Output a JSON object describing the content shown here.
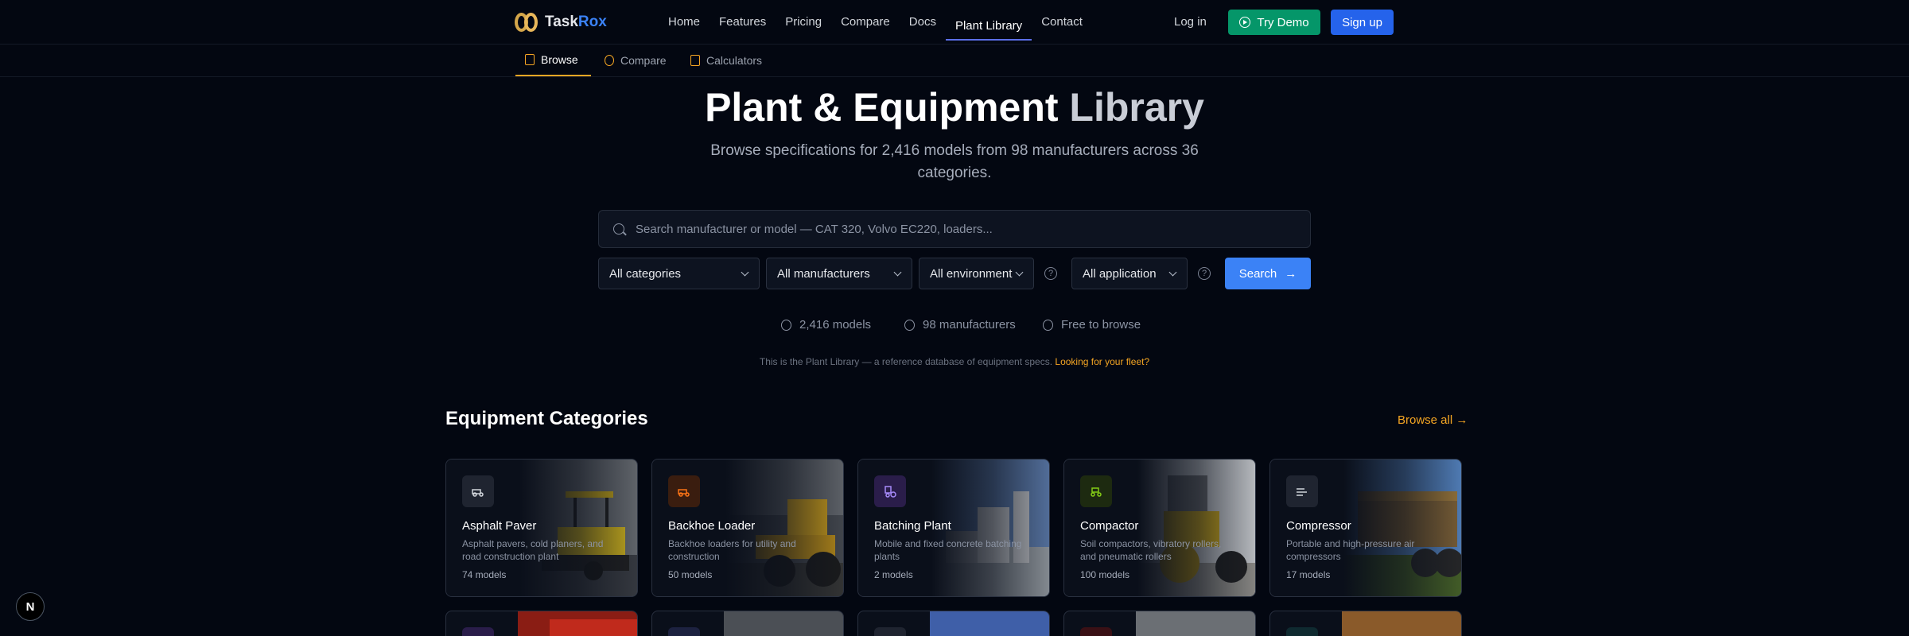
{
  "brand": {
    "name_part1": "Task",
    "name_part2": "Rox"
  },
  "nav": {
    "links": [
      "Home",
      "Features",
      "Pricing",
      "Compare",
      "Docs",
      "Plant Library",
      "Contact"
    ],
    "login": "Log in",
    "demo": "Try Demo",
    "signup": "Sign up"
  },
  "subnav": {
    "tabs": [
      "Browse",
      "Compare",
      "Calculators"
    ]
  },
  "hero": {
    "title_main": "Plant & Equipment ",
    "title_fade": "Library",
    "subtitle": "Browse specifications for 2,416 models from 98 manufacturers across 36 categories."
  },
  "search": {
    "placeholder": "Search manufacturer or model — CAT 320, Volvo EC220, loaders...",
    "button": "Search"
  },
  "filters": {
    "category": "All categories",
    "manufacturer": "All manufacturers",
    "environment": "All environment",
    "application": "All application"
  },
  "stats": {
    "models": "2,416 models",
    "manufacturers": "98 manufacturers",
    "free": "Free to browse"
  },
  "disclaimer": {
    "text": "This is the Plant Library — a reference database of equipment specs. ",
    "link": "Looking for your fleet?"
  },
  "section": {
    "title": "Equipment Categories",
    "browse_all": "Browse all"
  },
  "categories": [
    {
      "name": "Asphalt Paver",
      "desc": "Asphalt pavers, cold planers, and road construction plant",
      "count": "74 models",
      "accent": "#9ca3af"
    },
    {
      "name": "Backhoe Loader",
      "desc": "Backhoe loaders for utility and construction",
      "count": "50 models",
      "accent": "#f97316"
    },
    {
      "name": "Batching Plant",
      "desc": "Mobile and fixed concrete batching plants",
      "count": "2 models",
      "accent": "#a78bfa"
    },
    {
      "name": "Compactor",
      "desc": "Soil compactors, vibratory rollers, and pneumatic rollers",
      "count": "100 models",
      "accent": "#84cc16"
    },
    {
      "name": "Compressor",
      "desc": "Portable and high-pressure air compressors",
      "count": "17 models",
      "accent": "#9ca3af"
    }
  ],
  "colors": {
    "background": "#030711",
    "primary": "#3b82f6",
    "demo": "#059669",
    "accent": "#f5a623"
  }
}
